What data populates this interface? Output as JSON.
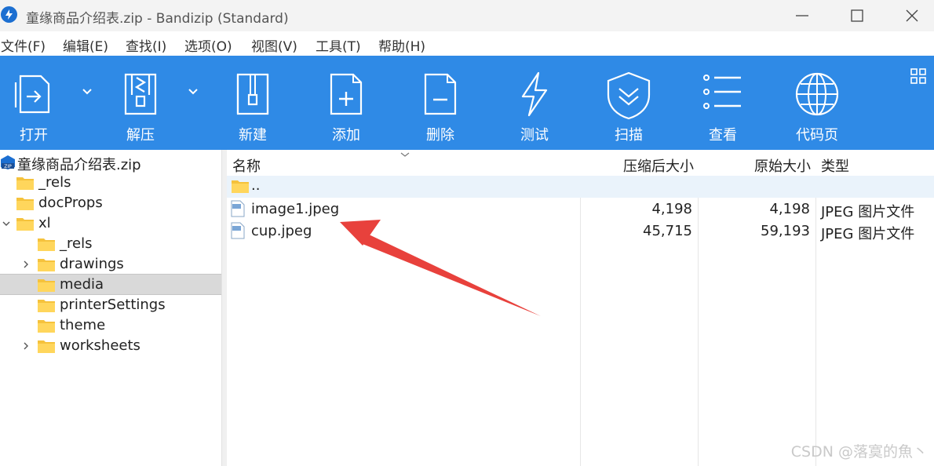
{
  "window": {
    "title": "童缘商品介绍表.zip - Bandizip (Standard)",
    "controls": [
      "minimize",
      "maximize",
      "close"
    ]
  },
  "menu": [
    "文件(F)",
    "编辑(E)",
    "查找(I)",
    "选项(O)",
    "视图(V)",
    "工具(T)",
    "帮助(H)"
  ],
  "toolbar": {
    "background": "#2f8ae6",
    "buttons": [
      {
        "label": "打开",
        "icon": "open-icon"
      },
      {
        "label": "解压",
        "icon": "extract-icon"
      },
      {
        "label": "新建",
        "icon": "new-archive-icon"
      },
      {
        "label": "添加",
        "icon": "add-icon"
      },
      {
        "label": "删除",
        "icon": "delete-icon"
      },
      {
        "label": "测试",
        "icon": "test-icon"
      },
      {
        "label": "扫描",
        "icon": "scan-icon"
      },
      {
        "label": "查看",
        "icon": "view-icon"
      },
      {
        "label": "代码页",
        "icon": "codepage-icon"
      }
    ]
  },
  "tree": {
    "root": "童缘商品介绍表.zip",
    "items": [
      {
        "label": "_rels"
      },
      {
        "label": "docProps"
      },
      {
        "label": "xl",
        "expanded": true
      },
      {
        "label": "_rels"
      },
      {
        "label": "drawings",
        "collapsed": true
      },
      {
        "label": "media",
        "selected": true
      },
      {
        "label": "printerSettings"
      },
      {
        "label": "theme"
      },
      {
        "label": "worksheets",
        "collapsed": true
      }
    ]
  },
  "list": {
    "columns": {
      "name": "名称",
      "compressed": "压缩后大小",
      "original": "原始大小",
      "type": "类型"
    },
    "parent_label": "..",
    "rows": [
      {
        "name": "image1.jpeg",
        "compressed": "4,198",
        "original": "4,198",
        "type": "JPEG 图片文件"
      },
      {
        "name": "cup.jpeg",
        "compressed": "45,715",
        "original": "59,193",
        "type": "JPEG 图片文件"
      }
    ]
  },
  "annotation": {
    "color": "#e8413c"
  },
  "watermark": "CSDN @落寞的魚丶"
}
